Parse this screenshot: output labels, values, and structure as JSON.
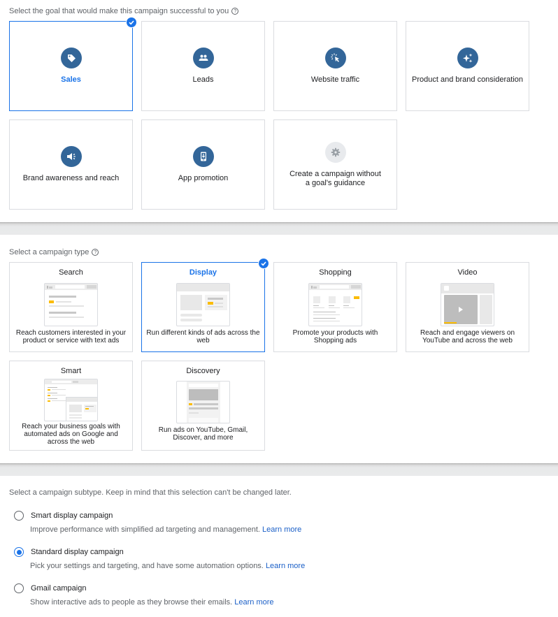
{
  "goals": {
    "label": "Select the goal that would make this campaign successful to you",
    "help_icon": "?",
    "items": [
      {
        "label": "Sales",
        "icon": "tag-icon",
        "selected": true
      },
      {
        "label": "Leads",
        "icon": "people-icon",
        "selected": false
      },
      {
        "label": "Website traffic",
        "icon": "cursor-click-icon",
        "selected": false
      },
      {
        "label": "Product and brand consideration",
        "icon": "sparkle-icon",
        "selected": false
      },
      {
        "label": "Brand awareness and reach",
        "icon": "megaphone-icon",
        "selected": false
      },
      {
        "label": "App promotion",
        "icon": "phone-download-icon",
        "selected": false
      },
      {
        "label": "Create a campaign without a goal's guidance",
        "icon": "gear-icon",
        "selected": false
      }
    ]
  },
  "campaign_types": {
    "label": "Select a campaign type",
    "help_icon": "?",
    "items": [
      {
        "title": "Search",
        "description": "Reach customers interested in your product or service with text ads",
        "selected": false
      },
      {
        "title": "Display",
        "description": "Run different kinds of ads across the web",
        "selected": true
      },
      {
        "title": "Shopping",
        "description": "Promote your products with Shopping ads",
        "selected": false
      },
      {
        "title": "Video",
        "description": "Reach and engage viewers on YouTube and across the web",
        "selected": false
      },
      {
        "title": "Smart",
        "description": "Reach your business goals with automated ads on Google and across the web",
        "selected": false
      },
      {
        "title": "Discovery",
        "description": "Run ads on YouTube, Gmail, Discover, and more",
        "selected": false
      }
    ]
  },
  "subtypes": {
    "label": "Select a campaign subtype. Keep in mind that this selection can't be changed later.",
    "items": [
      {
        "label": "Smart display campaign",
        "description": "Improve performance with simplified ad targeting and management.",
        "link": "Learn more",
        "checked": false
      },
      {
        "label": "Standard display campaign",
        "description": "Pick your settings and targeting, and have some automation options.",
        "link": "Learn more",
        "checked": true
      },
      {
        "label": "Gmail campaign",
        "description": "Show interactive ads to people as they browse their emails.",
        "link": "Learn more",
        "checked": false
      }
    ]
  },
  "colors": {
    "accent": "#1a73e8",
    "icon_circle": "#336699",
    "ad_highlight": "#fbbc04"
  }
}
